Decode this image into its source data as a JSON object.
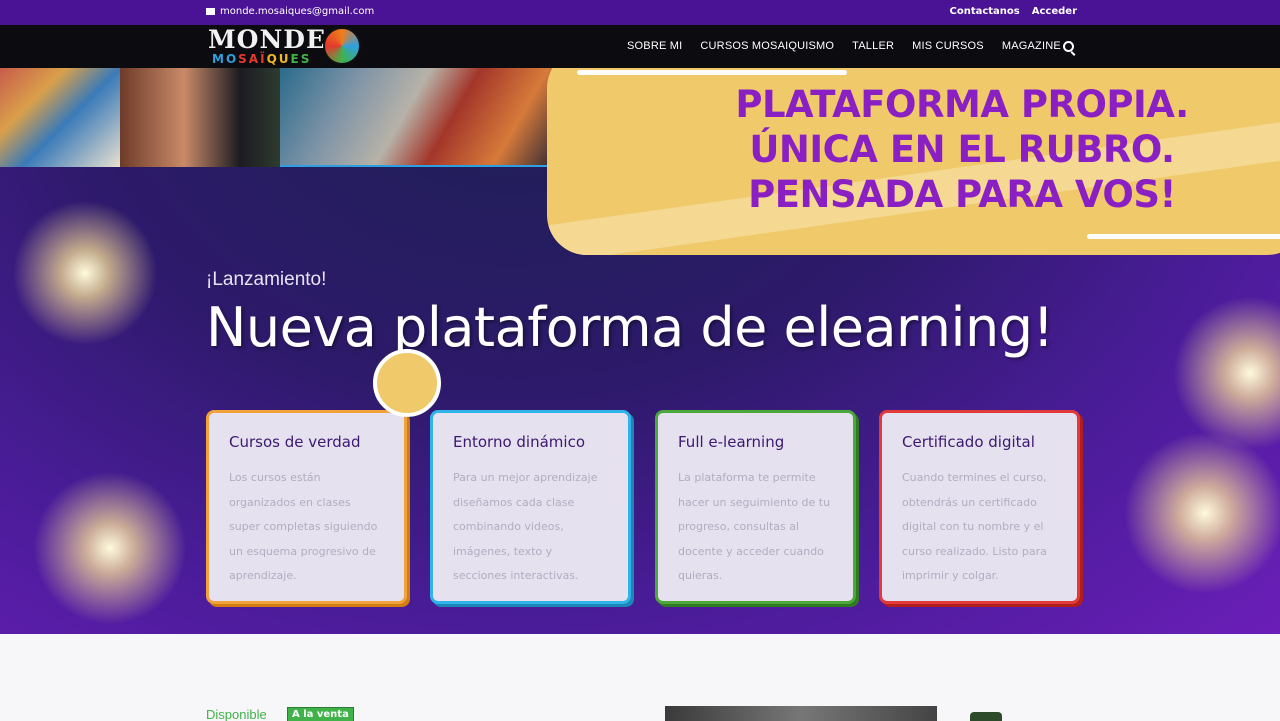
{
  "topbar": {
    "email": "monde.mosaiques@gmail.com",
    "links": [
      "Contactanos",
      "Acceder"
    ]
  },
  "header": {
    "logo_line1": "MONDE",
    "logo_line2": [
      "MO",
      "SAÏ",
      "QU",
      "ES"
    ],
    "nav": [
      "SOBRE MI",
      "CURSOS MOSAIQUISMO",
      "TALLER",
      "MIS CURSOS",
      "MAGAZINE"
    ]
  },
  "banner": {
    "lines": [
      "PLATAFORMA PROPIA.",
      "ÚNICA EN EL RUBRO.",
      "PENSADA PARA VOS!"
    ]
  },
  "hero": {
    "kicker": "¡Lanzamiento!",
    "headline": "Nueva plataforma de elearning!"
  },
  "cards": [
    {
      "title": "Cursos de verdad",
      "body": "Los cursos están organizados en clases super completas siguiendo un esquema progresivo de aprendizaje."
    },
    {
      "title": "Entorno dinámico",
      "body": "Para un mejor aprendizaje diseñamos cada clase combinando videos, imágenes, texto y secciones interactivas."
    },
    {
      "title": "Full e-learning",
      "body": "La plataforma te permite hacer un seguimiento de tu progreso, consultas al docente y acceder cuando quieras."
    },
    {
      "title": "Certificado digital",
      "body": "Cuando termines el curso, obtendrás un certificado digital con tu nombre y el curso realizado. Listo para imprimir y colgar."
    }
  ],
  "lower": {
    "available": "Disponible",
    "sale_badge": "A la venta"
  },
  "colors": {
    "topbar": "#4a1396",
    "banner_bg": "#f0c96a",
    "banner_text": "#8a1fc3",
    "card_borders": [
      "#f2a23a",
      "#2fb3e8",
      "#4ca83a",
      "#e23a3a"
    ]
  },
  "icons": {
    "email": "envelope-icon",
    "search": "search-icon"
  }
}
